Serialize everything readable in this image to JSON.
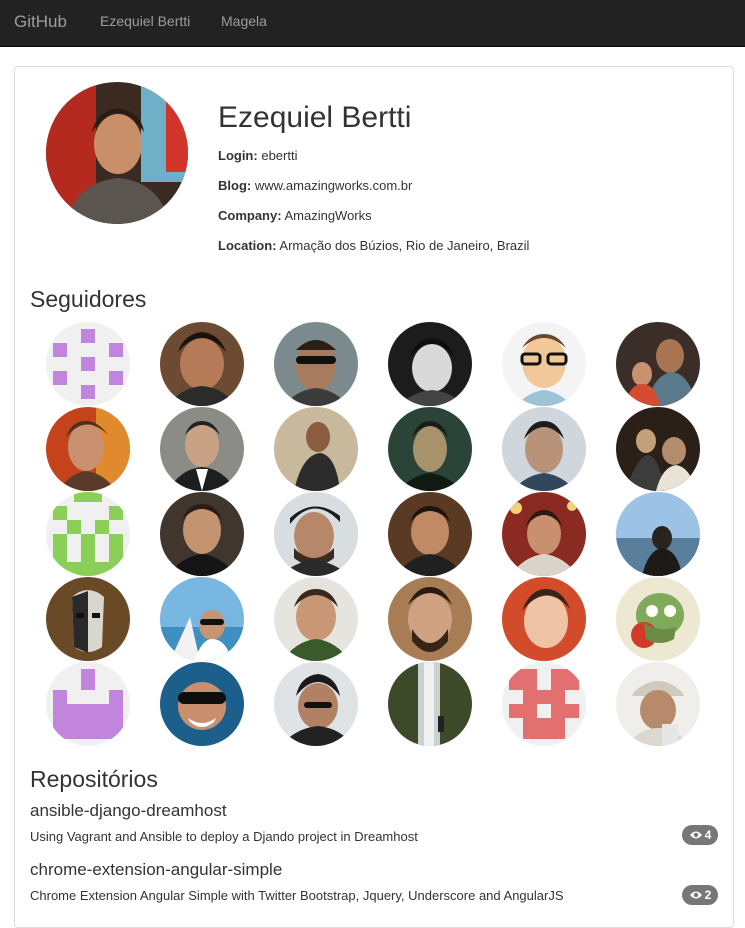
{
  "navbar": {
    "brand": "GitHub",
    "links": [
      "Ezequiel Bertti",
      "Magela"
    ]
  },
  "profile": {
    "name": "Ezequiel Bertti",
    "avatar_icon": "profile-photo",
    "fields": [
      {
        "label": "Login:",
        "value": "ebertti"
      },
      {
        "label": "Blog:",
        "value": "www.amazingworks.com.br"
      },
      {
        "label": "Company:",
        "value": "AmazingWorks"
      },
      {
        "label": "Location:",
        "value": "Armação dos Búzios, Rio de Janeiro, Brazil"
      }
    ]
  },
  "followers": {
    "title": "Seguidores",
    "count": 30
  },
  "repositories": {
    "title": "Repositórios",
    "items": [
      {
        "name": "ansible-django-dreamhost",
        "description": "Using Vagrant and Ansible to deploy a Djando project in Dreamhost",
        "watchers": "4"
      },
      {
        "name": "chrome-extension-angular-simple",
        "description": "Chrome Extension Angular Simple with Twitter Bootstrap, Jquery, Underscore and AngularJS",
        "watchers": "2"
      }
    ]
  },
  "colors": {
    "navbar_bg": "#222222",
    "nav_text": "#9d9d9d",
    "badge_bg": "#777777",
    "identicon_purple": "#c285dd",
    "identicon_green": "#8bcf59",
    "identicon_red": "#e37070"
  }
}
